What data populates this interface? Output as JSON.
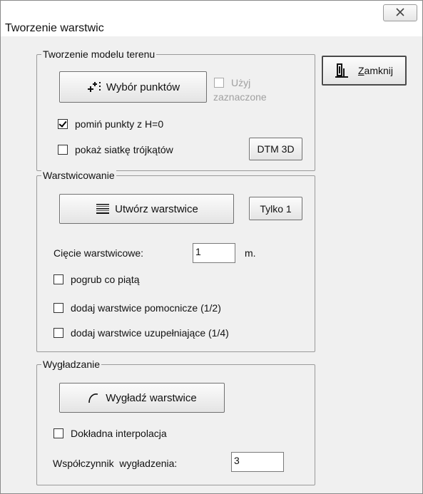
{
  "window": {
    "title": "Tworzenie warstwic"
  },
  "close_button": {
    "icon": "close-x-icon"
  },
  "terrain_model": {
    "legend": "Tworzenie modelu terenu",
    "select_points_button": "Wybór punktów",
    "use_selected": {
      "line1": "Użyj",
      "line2": "zaznaczone",
      "checked": false,
      "enabled": false
    },
    "skip_h0": {
      "label": "pomiń punkty z H=0",
      "checked": true
    },
    "show_triangles": {
      "label": "pokaż siatkę trójkątów",
      "checked": false
    },
    "dtm3d_button": "DTM 3D"
  },
  "contouring": {
    "legend": "Warstwicowanie",
    "create_button": "Utwórz warstwice",
    "only_one_button": "Tylko 1",
    "interval_label": "Cięcie warstwicowe:",
    "interval_value": "1",
    "interval_unit": "m.",
    "bold_every_fifth": {
      "label": "pogrub co piątą",
      "checked": false
    },
    "add_auxiliary": {
      "label": "dodaj warstwice pomocnicze (1/2)",
      "checked": false
    },
    "add_supplementary": {
      "label": "dodaj warstwice uzupełniające (1/4)",
      "checked": false
    }
  },
  "smoothing": {
    "legend": "Wygładzanie",
    "smooth_button": "Wygładź warstwice",
    "precise_interpolation": {
      "label": "Dokładna interpolacja",
      "checked": false
    },
    "factor_label": "Współczynnik  wygładzenia:",
    "factor_value": "3"
  },
  "close_dialog_button": {
    "mnemonic": "Z",
    "rest": "amknij"
  }
}
